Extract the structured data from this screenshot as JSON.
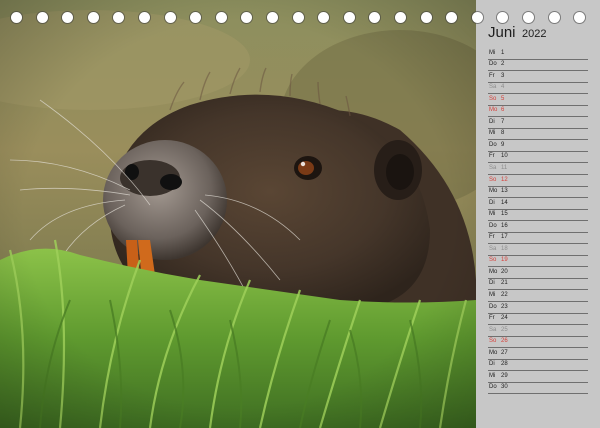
{
  "calendar": {
    "month": "Juni",
    "year": "2022",
    "days": [
      {
        "dow": "Mi",
        "day": "1",
        "type": "weekday"
      },
      {
        "dow": "Do",
        "day": "2",
        "type": "weekday"
      },
      {
        "dow": "Fr",
        "day": "3",
        "type": "weekday"
      },
      {
        "dow": "Sa",
        "day": "4",
        "type": "sat"
      },
      {
        "dow": "So",
        "day": "5",
        "type": "sun"
      },
      {
        "dow": "Mo",
        "day": "6",
        "type": "hol"
      },
      {
        "dow": "Di",
        "day": "7",
        "type": "weekday"
      },
      {
        "dow": "Mi",
        "day": "8",
        "type": "weekday"
      },
      {
        "dow": "Do",
        "day": "9",
        "type": "weekday"
      },
      {
        "dow": "Fr",
        "day": "10",
        "type": "weekday"
      },
      {
        "dow": "Sa",
        "day": "11",
        "type": "sat"
      },
      {
        "dow": "So",
        "day": "12",
        "type": "sun"
      },
      {
        "dow": "Mo",
        "day": "13",
        "type": "weekday"
      },
      {
        "dow": "Di",
        "day": "14",
        "type": "weekday"
      },
      {
        "dow": "Mi",
        "day": "15",
        "type": "weekday"
      },
      {
        "dow": "Do",
        "day": "16",
        "type": "weekday"
      },
      {
        "dow": "Fr",
        "day": "17",
        "type": "weekday"
      },
      {
        "dow": "Sa",
        "day": "18",
        "type": "sat"
      },
      {
        "dow": "So",
        "day": "19",
        "type": "sun"
      },
      {
        "dow": "Mo",
        "day": "20",
        "type": "weekday"
      },
      {
        "dow": "Di",
        "day": "21",
        "type": "weekday"
      },
      {
        "dow": "Mi",
        "day": "22",
        "type": "weekday"
      },
      {
        "dow": "Do",
        "day": "23",
        "type": "weekday"
      },
      {
        "dow": "Fr",
        "day": "24",
        "type": "weekday"
      },
      {
        "dow": "Sa",
        "day": "25",
        "type": "sat"
      },
      {
        "dow": "So",
        "day": "26",
        "type": "sun"
      },
      {
        "dow": "Mo",
        "day": "27",
        "type": "weekday"
      },
      {
        "dow": "Di",
        "day": "28",
        "type": "weekday"
      },
      {
        "dow": "Mi",
        "day": "29",
        "type": "weekday"
      },
      {
        "dow": "Do",
        "day": "30",
        "type": "weekday"
      }
    ]
  },
  "photo": {
    "subject": "nutria-photo",
    "colors": {
      "background": "#8a8a5a",
      "fur": "#4a3a2c",
      "grass": "#6aa83a",
      "sidebar": "#c7c7c7",
      "holiday": "#d6403a"
    }
  },
  "binding": {
    "hole_count": 23
  }
}
